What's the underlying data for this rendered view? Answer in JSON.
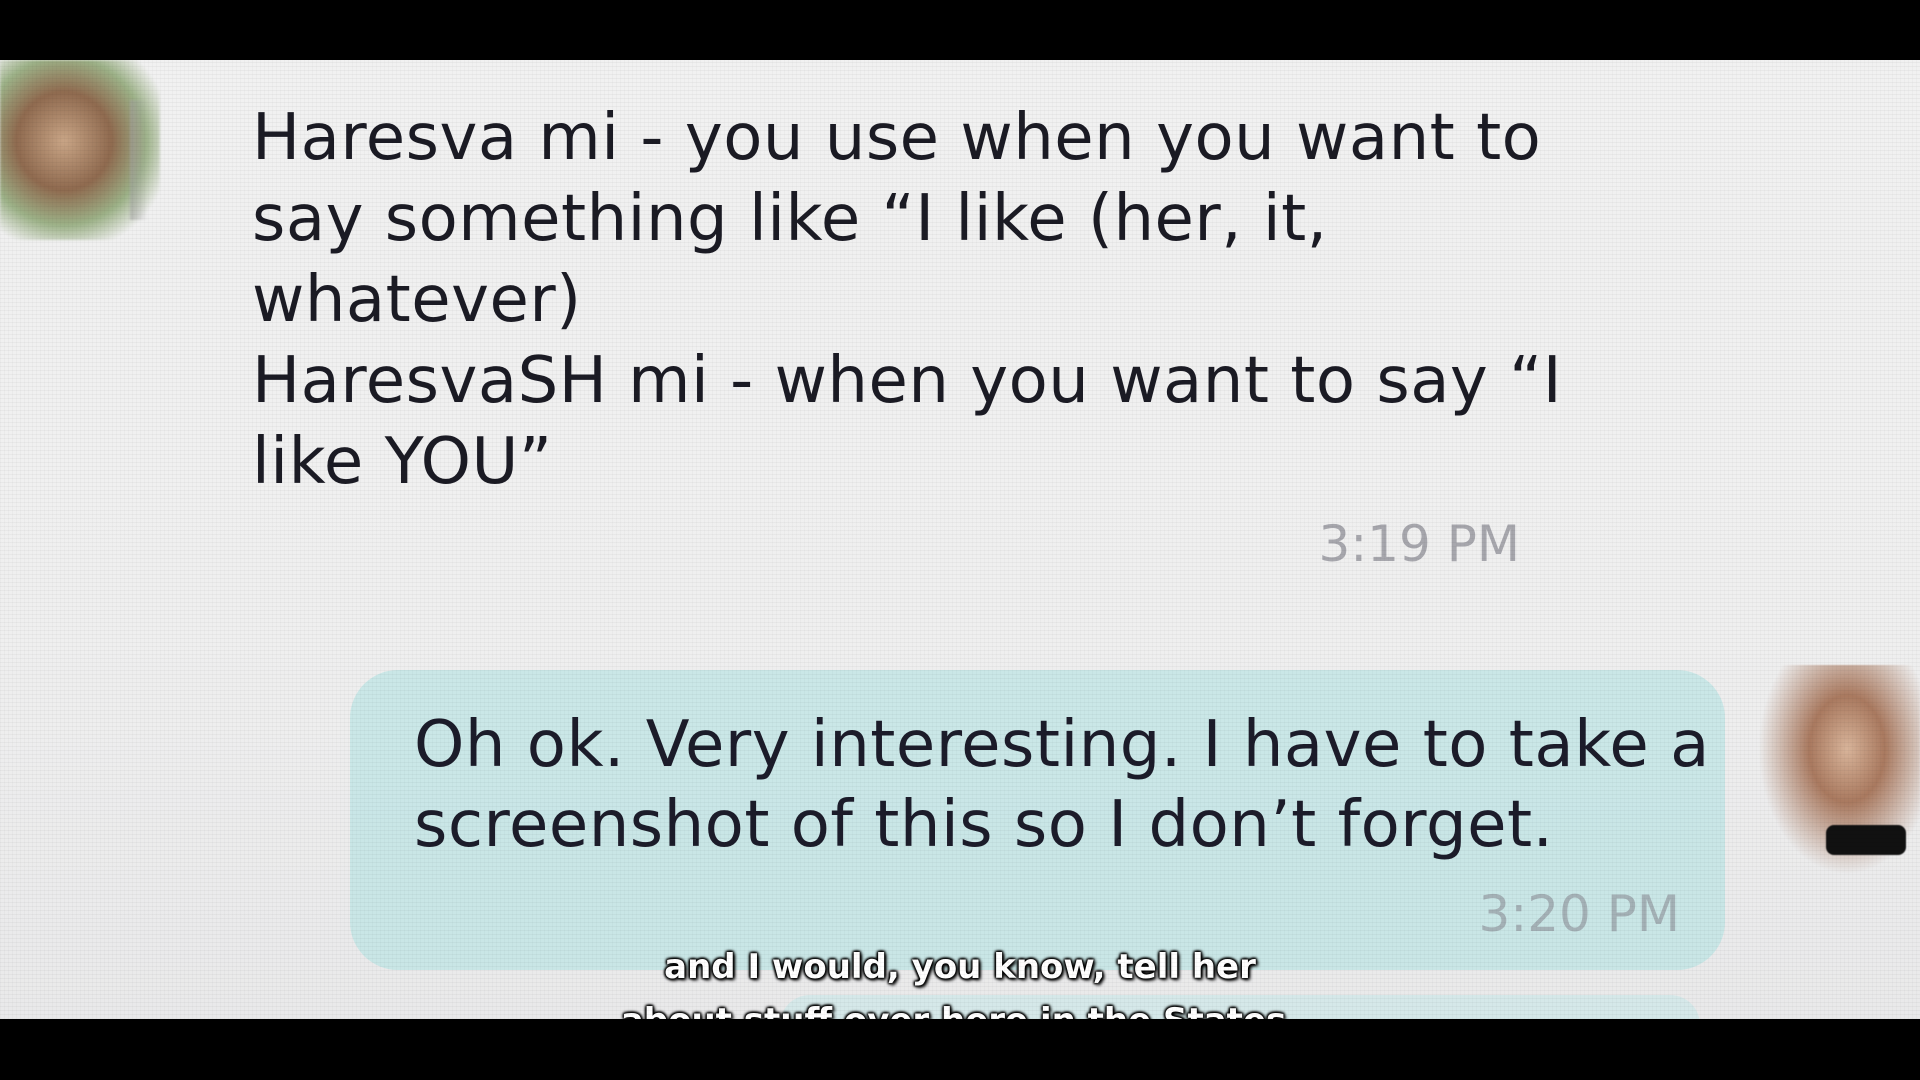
{
  "conversation": {
    "incoming_message": {
      "text": "Haresva mi - you use when you want to\nsay something like “I like (her, it,\nwhatever)\nHaresvaSH mi - when you want to say “I\nlike YOU”",
      "time": "3:19 PM"
    },
    "outgoing_message": {
      "text": "Oh ok. Very interesting. I have to take a\nscreenshot of this so I don’t forget.",
      "time": "3:20 PM"
    }
  },
  "subtitles": {
    "line1": "and I would, you know, tell her",
    "line2": "about stuff over here in the States."
  },
  "colors": {
    "outgoing_bubble": "#bee4e4",
    "message_text": "#1b1b24",
    "timestamp": "#a7a7ad"
  }
}
